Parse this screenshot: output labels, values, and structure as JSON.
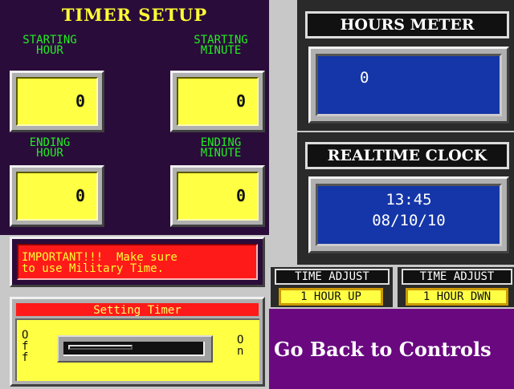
{
  "timer_setup": {
    "title": "TIMER SETUP",
    "starting_hour_label": "STARTING\nHOUR",
    "starting_minute_label": "STARTING\nMINUTE",
    "ending_hour_label": "ENDING\nHOUR",
    "ending_minute_label": "ENDING\nMINUTE",
    "starting_hour": "0",
    "starting_minute": "0",
    "ending_hour": "0",
    "ending_minute": "0"
  },
  "hours_meter": {
    "title": "HOURS METER",
    "value": "0"
  },
  "realtime_clock": {
    "title": "REALTIME CLOCK",
    "time": "13:45",
    "date": "08/10/10"
  },
  "warning": {
    "text": "IMPORTANT!!!  Make sure\nto use Military Time."
  },
  "time_adjust": [
    {
      "title": "TIME ADJUST",
      "button": "1 HOUR UP"
    },
    {
      "title": "TIME ADJUST",
      "button": "1 HOUR DWN"
    }
  ],
  "setting_timer": {
    "title": "Setting Timer",
    "off_label": "O\nf\nf",
    "on_label": "O\nn",
    "slider_level": 0
  },
  "navigation": {
    "back_label": "Go Back to Controls"
  },
  "colors": {
    "panel_bg": "#2a0c3a",
    "value_box": "#ffff44",
    "display_blue": "#1436a8",
    "label_green": "#22ee22",
    "title_yellow": "#ffff33",
    "warning_red": "#ff1a1a",
    "back_purple": "#6a0880"
  }
}
